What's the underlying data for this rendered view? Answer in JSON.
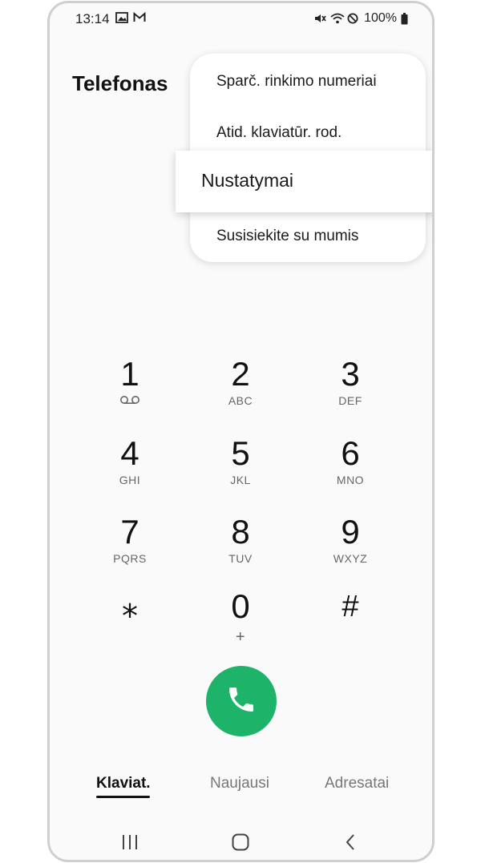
{
  "status_bar": {
    "time": "13:14",
    "battery": "100%",
    "icons": [
      "gallery-icon",
      "gmail-icon",
      "mute-icon",
      "wifi-icon",
      "do-not-disturb-icon",
      "battery-icon"
    ]
  },
  "app": {
    "title": "Telefonas"
  },
  "menu": {
    "items": [
      {
        "label": "Sparč. rinkimo numeriai"
      },
      {
        "label": "Atid. klaviatūr. rod."
      },
      {
        "label": "Nustatymai",
        "highlighted": true
      },
      {
        "label": "Susisiekite su mumis"
      }
    ]
  },
  "keypad": {
    "keys": [
      {
        "digit": "1",
        "letters": "",
        "icon": "voicemail-icon"
      },
      {
        "digit": "2",
        "letters": "ABC"
      },
      {
        "digit": "3",
        "letters": "DEF"
      },
      {
        "digit": "4",
        "letters": "GHI"
      },
      {
        "digit": "5",
        "letters": "JKL"
      },
      {
        "digit": "6",
        "letters": "MNO"
      },
      {
        "digit": "7",
        "letters": "PQRS"
      },
      {
        "digit": "8",
        "letters": "TUV"
      },
      {
        "digit": "9",
        "letters": "WXYZ"
      },
      {
        "digit": "⁎",
        "letters": ""
      },
      {
        "digit": "0",
        "letters": "+"
      },
      {
        "digit": "#",
        "letters": ""
      }
    ]
  },
  "call_button": {
    "icon": "phone-icon",
    "color": "#1db46a"
  },
  "tabs": [
    {
      "label": "Klaviat.",
      "active": true
    },
    {
      "label": "Naujausi"
    },
    {
      "label": "Adresatai"
    }
  ],
  "nav_bar": {
    "icons": [
      "recent-apps-icon",
      "home-icon",
      "back-icon"
    ]
  }
}
